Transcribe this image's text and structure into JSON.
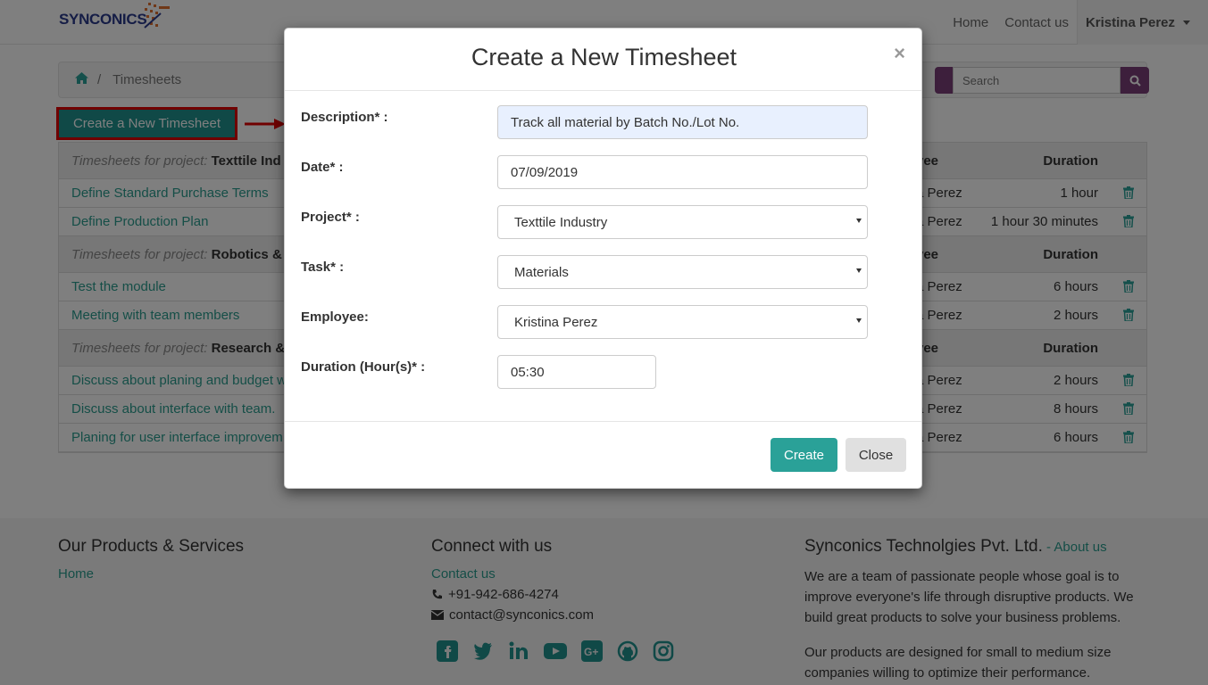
{
  "nav": {
    "brand": "SYNCONICS",
    "links": [
      "Home",
      "Contact us"
    ],
    "user": "Kristina Perez"
  },
  "breadcrumb": {
    "current": "Timesheets"
  },
  "search": {
    "placeholder": "Search"
  },
  "page": {
    "create_button": "Create a New Timesheet"
  },
  "table": {
    "group_prefix": "Timesheets for project:",
    "col_employee": "yee",
    "col_duration": "Duration",
    "groups": [
      {
        "project": "Texttile Ind",
        "rows": [
          {
            "description": "Define Standard Purchase Terms",
            "employee": "a Perez",
            "duration": "1 hour"
          },
          {
            "description": "Define Production Plan",
            "employee": "a Perez",
            "duration": "1 hour 30 minutes"
          }
        ]
      },
      {
        "project": "Robotics &",
        "rows": [
          {
            "description": "Test the module",
            "employee": "a Perez",
            "duration": "6 hours"
          },
          {
            "description": "Meeting with team members",
            "employee": "a Perez",
            "duration": "2 hours"
          }
        ]
      },
      {
        "project": "Research &",
        "rows": [
          {
            "description": "Discuss about planing and budget w",
            "employee": "a Perez",
            "duration": "2 hours"
          },
          {
            "description": "Discuss about interface with team.",
            "employee": "a Perez",
            "duration": "8 hours"
          },
          {
            "description": "Planing for user interface improvem",
            "employee": "a Perez",
            "duration": "6 hours"
          }
        ]
      }
    ]
  },
  "footer": {
    "products_title": "Our Products & Services",
    "products_link": "Home",
    "connect_title": "Connect with us",
    "contact_link": "Contact us",
    "phone": "+91-942-686-4274",
    "email": "contact@synconics.com",
    "company_title": "Synconics Technolgies Pvt. Ltd.",
    "about_sep": " - ",
    "about_link": "About us",
    "para1": "We are a team of passionate people whose goal is to improve everyone's life through disruptive products. We build great products to solve your business problems.",
    "para2": "Our products are designed for small to medium size companies willing to optimize their performance."
  },
  "modal": {
    "title": "Create a New Timesheet",
    "close_symbol": "×",
    "fields": {
      "description_label": "Description* :",
      "description_value": "Track all material by Batch No./Lot No.",
      "date_label": "Date* :",
      "date_value": "07/09/2019",
      "project_label": "Project* :",
      "project_value": "Texttile Industry",
      "task_label": "Task* :",
      "task_value": "Materials",
      "employee_label": "Employee:",
      "employee_value": "Kristina Perez",
      "duration_label": "Duration (Hour(s)* :",
      "duration_value": "05:30"
    },
    "create_label": "Create",
    "close_label": "Close"
  },
  "colors": {
    "accent": "#2aa198",
    "highlight": "#e00000",
    "search": "#7b3f78"
  }
}
